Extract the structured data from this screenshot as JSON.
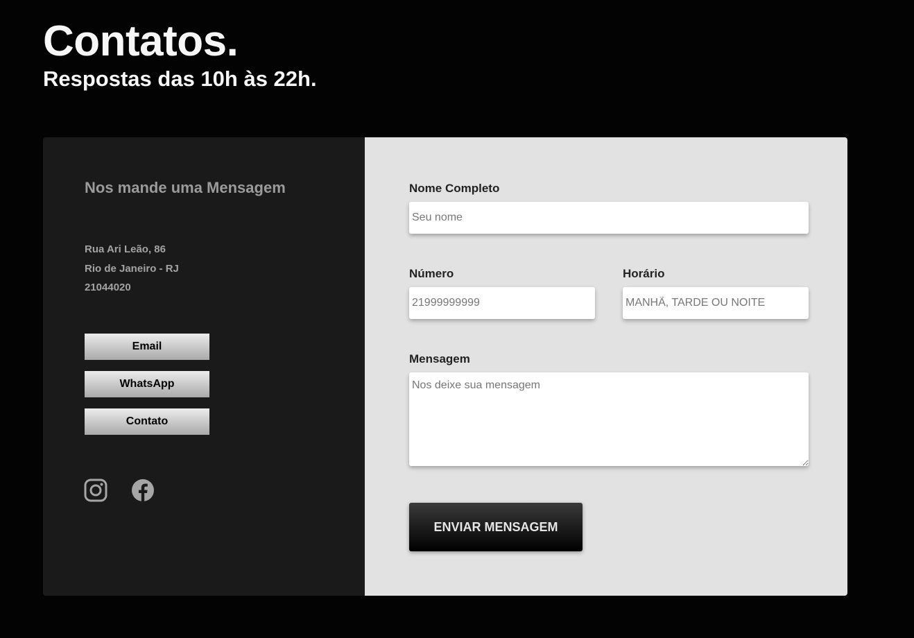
{
  "header": {
    "title": "Contatos.",
    "subtitle": "Respostas das 10h às 22h."
  },
  "info_panel": {
    "heading": "Nos mande uma Mensagem",
    "address": {
      "street": "Rua Ari Leão, 86",
      "city": "Rio de Janeiro - RJ",
      "zip": "21044020"
    },
    "buttons": {
      "email": "Email",
      "whatsapp": "WhatsApp",
      "contato": "Contato"
    },
    "social": [
      "instagram-icon",
      "facebook-icon"
    ]
  },
  "form": {
    "name": {
      "label": "Nome Completo",
      "placeholder": "Seu nome",
      "value": ""
    },
    "phone": {
      "label": "Número",
      "placeholder": "21999999999",
      "value": ""
    },
    "time": {
      "label": "Horário",
      "placeholder": "MANHÃ, TARDE OU NOITE",
      "value": ""
    },
    "message": {
      "label": "Mensagem",
      "placeholder": "Nos deixe sua mensagem",
      "value": ""
    },
    "submit_label": "ENVIAR MENSAGEM"
  },
  "colors": {
    "page_background": "#030303",
    "info_panel_background": "#1a1a1a",
    "form_panel_background": "#e2e2e2",
    "muted_text": "#9b9b9b"
  }
}
